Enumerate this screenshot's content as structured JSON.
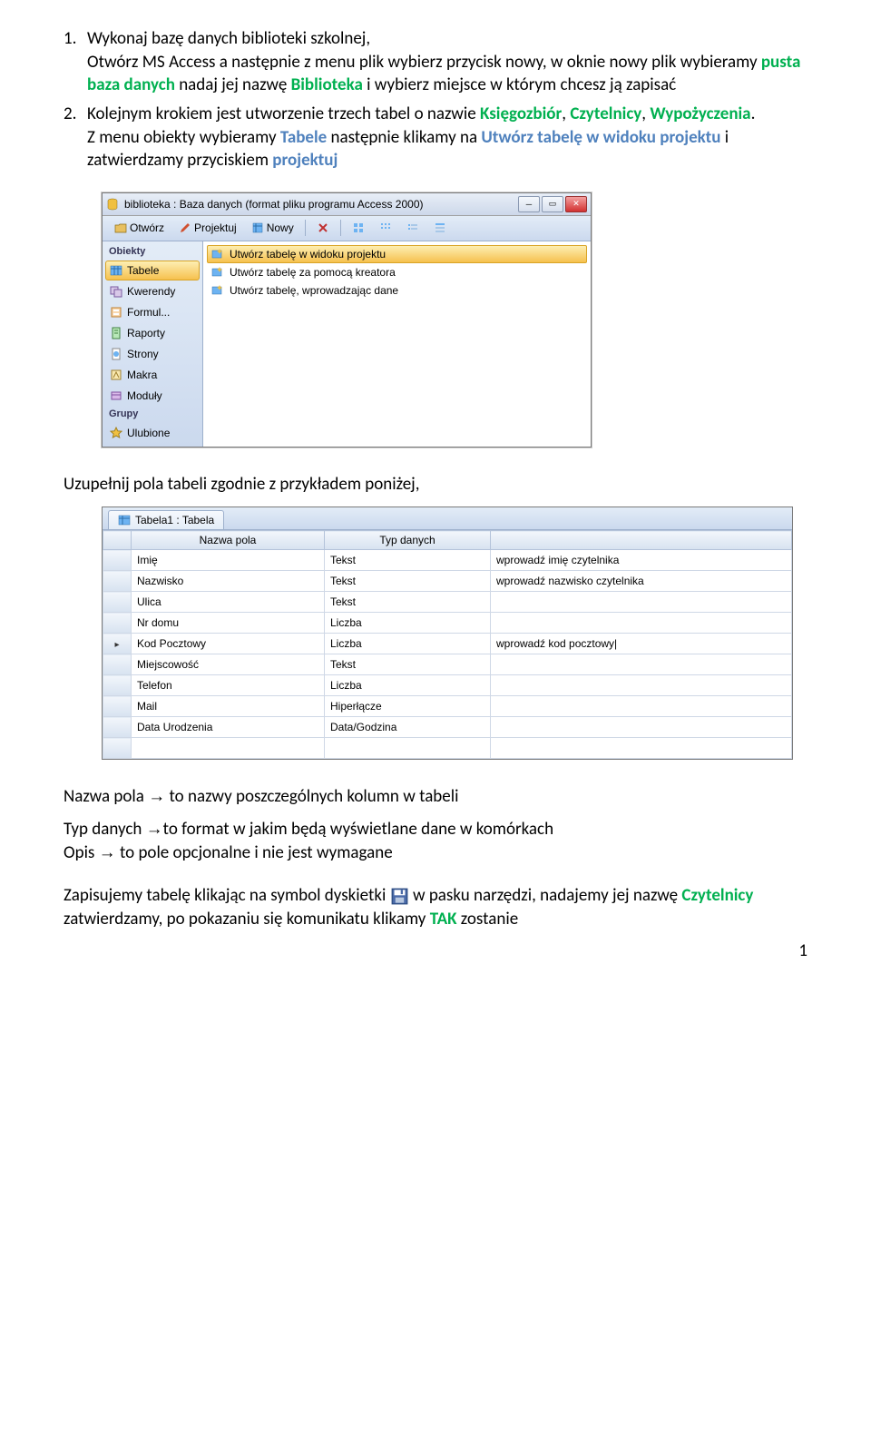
{
  "doc": {
    "page_number": "1",
    "arrow": "→"
  },
  "items": [
    {
      "num": "1.",
      "parts": [
        {
          "t": "Wykonaj bazę danych biblioteki szkolnej,"
        },
        {
          "t": "Otwórz MS Access a następnie z menu plik wybierz przycisk nowy, w oknie nowy plik wybieramy "
        },
        {
          "green": "pusta baza danych"
        },
        {
          "t": " nadaj jej nazwę "
        },
        {
          "green": "Biblioteka"
        },
        {
          "t": " i wybierz miejsce w którym chcesz ją zapisać"
        }
      ]
    },
    {
      "num": "2.",
      "parts": [
        {
          "t": "Kolejnym krokiem jest utworzenie trzech tabel o nazwie "
        },
        {
          "green": "Księgozbiór"
        },
        {
          "t": ", "
        },
        {
          "green": "Czytelnicy"
        },
        {
          "t": ", "
        },
        {
          "green": "Wypożyczenia"
        },
        {
          "t": "."
        }
      ],
      "parts2": [
        {
          "t": "Z menu obiekty wybieramy "
        },
        {
          "blue": "Tabele"
        },
        {
          "t": " następnie klikamy na "
        },
        {
          "blue": "Utwórz tabelę w widoku projektu"
        },
        {
          "t": " i zatwierdzamy przyciskiem "
        },
        {
          "blue": "projektuj"
        }
      ]
    }
  ],
  "win1": {
    "title": "biblioteka : Baza danych (format pliku programu Access 2000)",
    "toolbar": {
      "open": "Otwórz",
      "design": "Projektuj",
      "new": "Nowy"
    },
    "side_header1": "Obiekty",
    "side_items": [
      "Tabele",
      "Kwerendy",
      "Formul...",
      "Raporty",
      "Strony",
      "Makra",
      "Moduły"
    ],
    "side_header2": "Grupy",
    "side_items2": [
      "Ulubione"
    ],
    "list_items": [
      "Utwórz tabelę w widoku projektu",
      "Utwórz tabelę za pomocą kreatora",
      "Utwórz tabelę, wprowadzając dane"
    ]
  },
  "mid_para": "Uzupełnij pola tabeli zgodnie z przykładem poniżej,",
  "win2": {
    "tab": "Tabela1 : Tabela",
    "cols": [
      "Nazwa pola",
      "Typ danych",
      ""
    ],
    "rows": [
      {
        "f": "Imię",
        "t": "Tekst",
        "d": "wprowadź imię czytelnika",
        "cur": false
      },
      {
        "f": "Nazwisko",
        "t": "Tekst",
        "d": "wprowadź nazwisko czytelnika",
        "cur": false
      },
      {
        "f": "Ulica",
        "t": "Tekst",
        "d": "",
        "cur": false
      },
      {
        "f": "Nr domu",
        "t": "Liczba",
        "d": "",
        "cur": false
      },
      {
        "f": "Kod Pocztowy",
        "t": "Liczba",
        "d": "wprowadź kod pocztowy|",
        "cur": true
      },
      {
        "f": "Miejscowość",
        "t": "Tekst",
        "d": "",
        "cur": false
      },
      {
        "f": "Telefon",
        "t": "Liczba",
        "d": "",
        "cur": false
      },
      {
        "f": "Mail",
        "t": "Hiperłącze",
        "d": "",
        "cur": false
      },
      {
        "f": "Data Urodzenia",
        "t": "Data/Godzina",
        "d": "",
        "cur": false
      },
      {
        "f": "",
        "t": "",
        "d": "",
        "cur": false
      }
    ]
  },
  "after": {
    "l1a": "Nazwa pola ",
    "l1b": " to nazwy poszczególnych kolumn w tabeli",
    "l2a": "Typ danych ",
    "l2b": "to format w jakim będą wyświetlane dane w komórkach",
    "l3a": "Opis ",
    "l3b": " to pole opcjonalne i nie jest wymagane",
    "l4a": "Zapisujemy tabelę klikając na symbol dyskietki ",
    "l4b": " w pasku narzędzi, nadajemy jej nazwę ",
    "l4c": "Czytelnicy",
    "l4d": " zatwierdzamy, po pokazaniu się komunikatu klikamy ",
    "l4e": "TAK",
    "l4f": " zostanie"
  }
}
